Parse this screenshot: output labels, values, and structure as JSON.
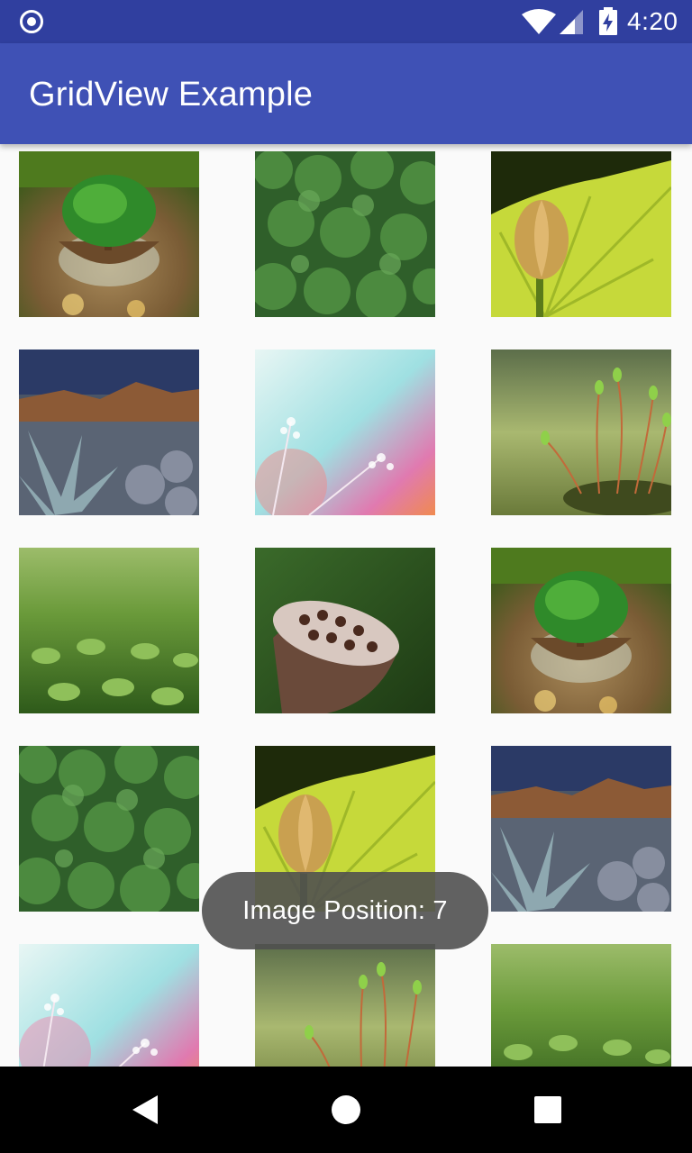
{
  "status_bar": {
    "time": "4:20",
    "icons": [
      "notification-icon",
      "wifi-icon",
      "signal-icon",
      "battery-charging-icon"
    ]
  },
  "app_bar": {
    "title": "GridView Example"
  },
  "grid": {
    "columns": 3,
    "items": [
      {
        "position": 0,
        "image": "terrarium-tree"
      },
      {
        "position": 1,
        "image": "green-moss"
      },
      {
        "position": 2,
        "image": "lotus-bud-leaf"
      },
      {
        "position": 3,
        "image": "agave-mountains"
      },
      {
        "position": 4,
        "image": "pastel-flowers"
      },
      {
        "position": 5,
        "image": "sprouts"
      },
      {
        "position": 6,
        "image": "green-leaves-field"
      },
      {
        "position": 7,
        "image": "lotus-seed-pod"
      },
      {
        "position": 8,
        "image": "terrarium-tree"
      },
      {
        "position": 9,
        "image": "green-moss"
      },
      {
        "position": 10,
        "image": "lotus-bud-leaf"
      },
      {
        "position": 11,
        "image": "agave-mountains"
      },
      {
        "position": 12,
        "image": "pastel-flowers"
      },
      {
        "position": 13,
        "image": "sprouts"
      },
      {
        "position": 14,
        "image": "green-leaves-field"
      }
    ]
  },
  "toast": {
    "text": "Image Position: 7"
  },
  "nav_bar": {
    "buttons": [
      "back-icon",
      "home-icon",
      "recents-icon"
    ]
  },
  "colors": {
    "status_bar": "#303f9f",
    "app_bar": "#3f51b5",
    "background": "#fafafa",
    "toast": "#505050"
  }
}
